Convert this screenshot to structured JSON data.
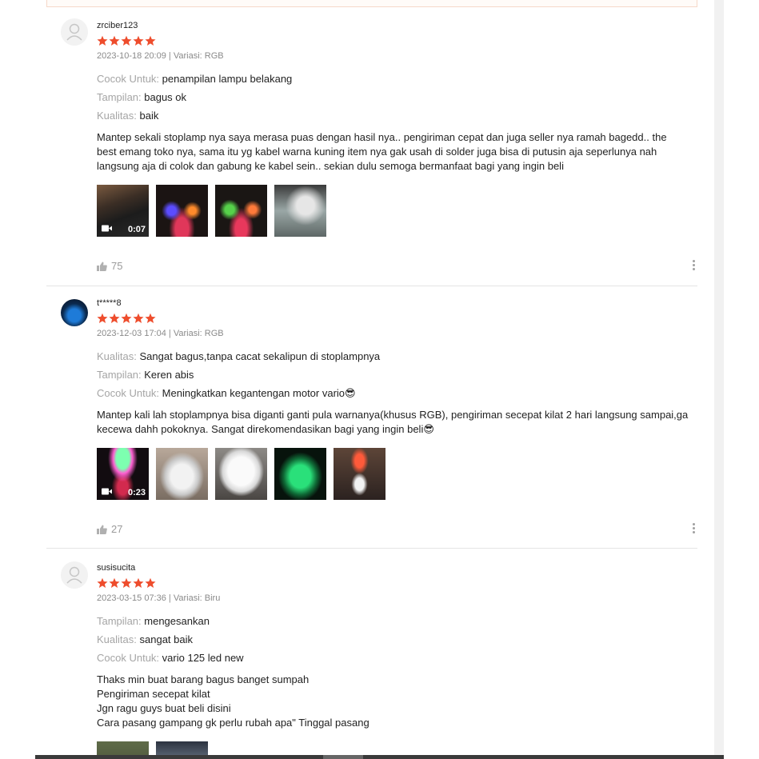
{
  "reviews": [
    {
      "username": "zrciber123",
      "rating": 5,
      "date": "2023-10-18 20:09",
      "variation": "Variasi: RGB",
      "attributes": [
        {
          "label": "Cocok Untuk:",
          "value": "penampilan lampu belakang"
        },
        {
          "label": "Tampilan:",
          "value": "bagus ok"
        },
        {
          "label": "Kualitas:",
          "value": "baik"
        }
      ],
      "comment": "Mantep sekali stoplamp nya saya merasa puas dengan hasil nya.. pengiriman cepat dan juga seller nya ramah bagedd.. the best emang toko nya, sama itu yg kabel warna kuning item nya gak usah di solder juga bisa di putusin aja seperlunya nah langsung aja di colok dan gabung ke kabel sein.. sekian dulu semoga bermanfaat bagi yang ingin beli",
      "video_duration": "0:07",
      "likes": "75"
    },
    {
      "username": "t*****8",
      "rating": 5,
      "date": "2023-12-03 17:04",
      "variation": "Variasi: RGB",
      "attributes": [
        {
          "label": "Kualitas:",
          "value": "Sangat bagus,tanpa cacat sekalipun di stoplampnya"
        },
        {
          "label": "Tampilan:",
          "value": "Keren abis"
        },
        {
          "label": "Cocok Untuk:",
          "value": "Meningkatkan kegantengan motor vario😎"
        }
      ],
      "comment": "Mantep kali lah stoplampnya bisa diganti ganti pula warnanya(khusus RGB), pengiriman secepat kilat 2 hari langsung sampai,ga kecewa dahh pokoknya. Sangat direkomendasikan bagi yang ingin beli😎",
      "video_duration": "0:23",
      "likes": "27"
    },
    {
      "username": "susisucita",
      "rating": 5,
      "date": "2023-03-15 07:36",
      "variation": "Variasi: Biru",
      "attributes": [
        {
          "label": "Tampilan:",
          "value": "mengesankan"
        },
        {
          "label": "Kualitas:",
          "value": "sangat baik"
        },
        {
          "label": "Cocok Untuk:",
          "value": "vario 125 led new"
        }
      ],
      "comment": "Thaks min buat barang bagus banget sumpah\nPengiriman secepat kilat\nJgn ragu guys buat beli disini\nCara pasang gampang gk perlu rubah apa\" Tinggal pasang"
    }
  ],
  "separator": "|",
  "colors": {
    "star": "#ee4d2d",
    "label": "#a5a5a5",
    "meta": "#8a8a8a"
  }
}
